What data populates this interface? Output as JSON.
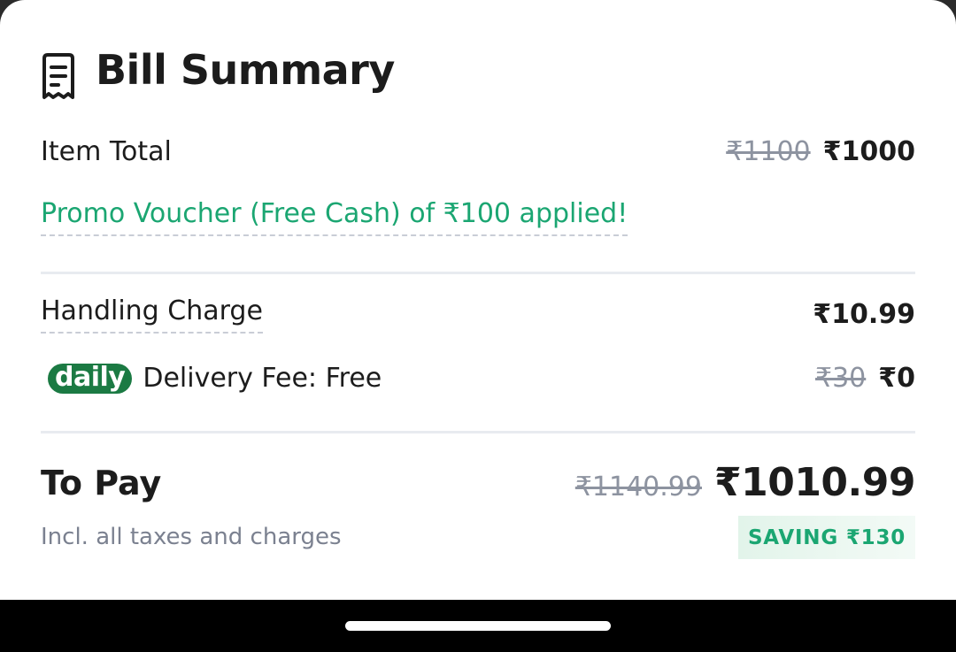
{
  "header": {
    "title": "Bill Summary",
    "icon": "receipt-icon"
  },
  "item_total": {
    "label": "Item Total",
    "original": "₹1100",
    "amount": "₹1000"
  },
  "promo": {
    "text": "Promo Voucher (Free Cash) of ₹100 applied!"
  },
  "handling": {
    "label": "Handling Charge",
    "amount": "₹10.99"
  },
  "delivery": {
    "badge": "daily",
    "label": "Delivery Fee: Free",
    "original": "₹30",
    "amount": "₹0"
  },
  "to_pay": {
    "label": "To Pay",
    "original": "₹1140.99",
    "amount": "₹1010.99",
    "subtext": "Incl. all taxes and charges",
    "saving": "SAVING ₹130"
  },
  "colors": {
    "accent_green": "#1ba672",
    "badge_green": "#1b7a43",
    "muted": "#8d93a0"
  }
}
